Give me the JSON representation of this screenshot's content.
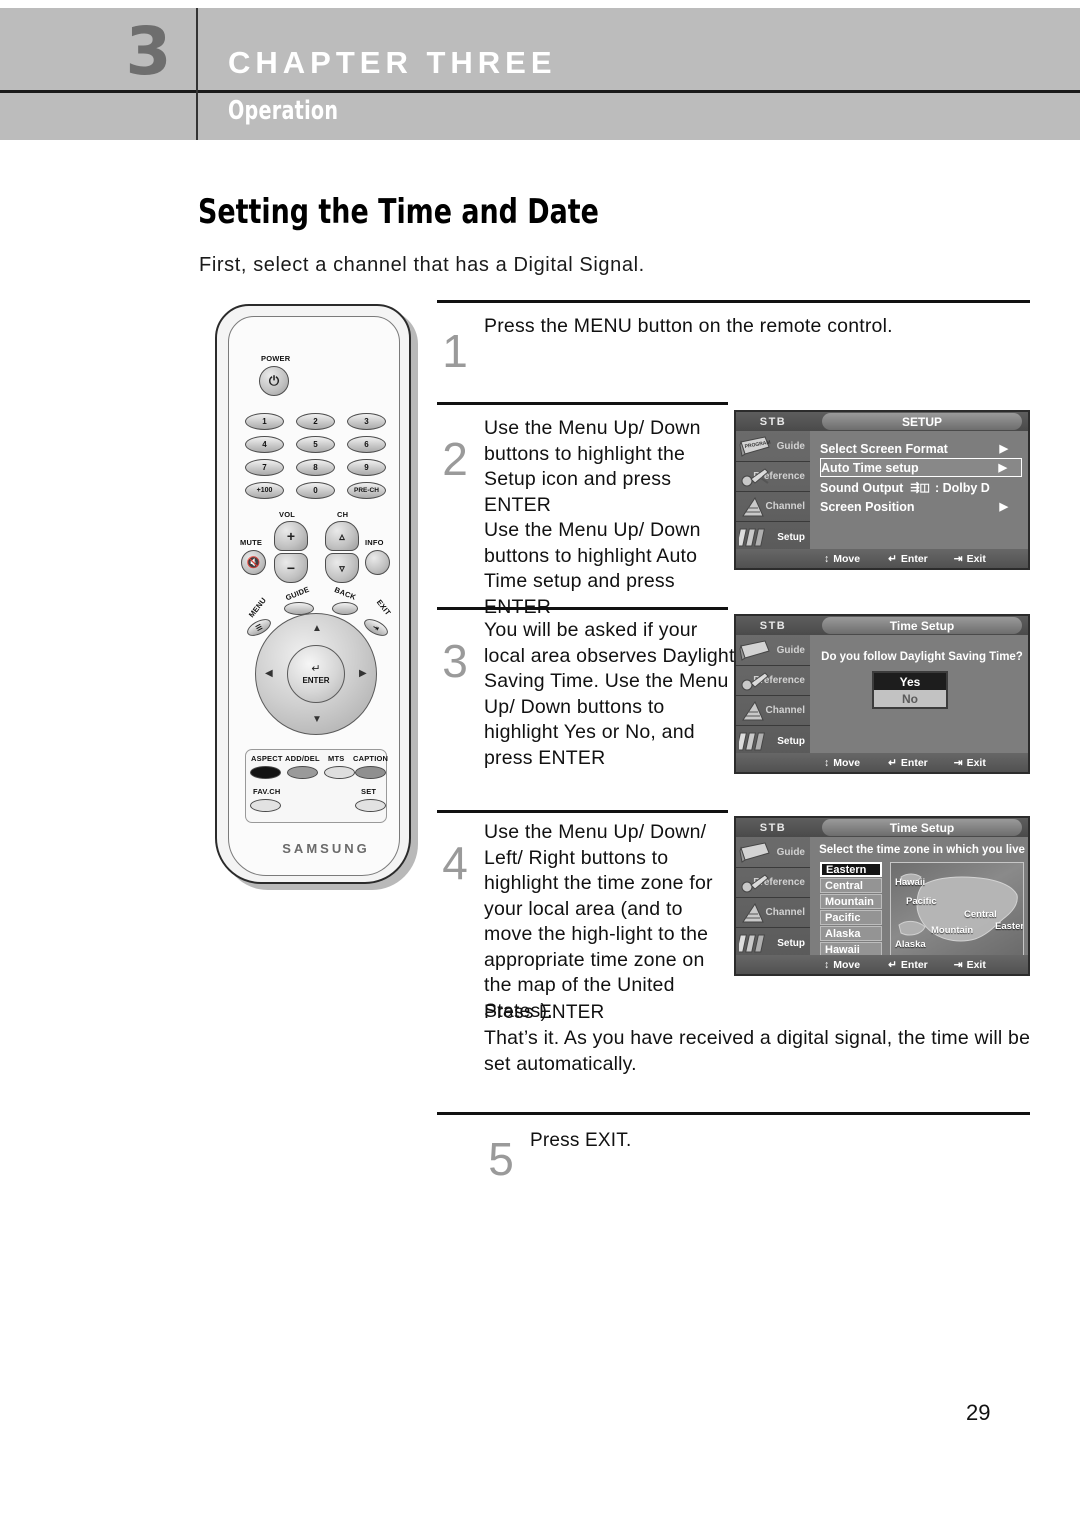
{
  "header": {
    "chapter_number": "3",
    "chapter_title": "CHAPTER THREE",
    "chapter_subtitle": "Operation"
  },
  "page": {
    "title": "Setting the Time and Date",
    "intro": "First, select a channel that has a Digital Signal.",
    "page_number": "29"
  },
  "remote": {
    "brand": "SAMSUNG",
    "power_label": "POWER",
    "keypad": [
      "1",
      "2",
      "3",
      "4",
      "5",
      "6",
      "7",
      "8",
      "9",
      "+100",
      "0",
      "PRE-CH"
    ],
    "vol_label": "VOL",
    "ch_label": "CH",
    "mute_label": "MUTE",
    "info_label": "INFO",
    "menu_label": "MENU",
    "guide_label": "GUIDE",
    "back_label": "BACK",
    "exit_label": "EXIT",
    "enter_label": "ENTER",
    "function_buttons": [
      "ASPECT",
      "ADD/DEL",
      "MTS",
      "CAPTION",
      "FAV.CH",
      "SET"
    ]
  },
  "steps": [
    {
      "number": "1",
      "text": "Press the MENU button on the remote control."
    },
    {
      "number": "2",
      "text": "Use the Menu Up/ Down buttons to highlight the Setup icon and press ENTER\nUse the Menu Up/ Down buttons to highlight Auto Time setup and press ENTER"
    },
    {
      "number": "3",
      "text": "You will be asked if your local area observes Daylight Saving Time. Use the Menu Up/ Down buttons to highlight Yes or No, and press ENTER"
    },
    {
      "number": "4",
      "text": "Use the Menu Up/ Down/ Left/ Right buttons to highlight the time zone for your local area (and to move the high-light to the appropriate time zone on the map of the United States).",
      "extra1": "Press ENTER",
      "extra2": "That’s it. As you have received a digital signal, the time will be set automatically."
    },
    {
      "number": "5",
      "text": "Press EXIT."
    }
  ],
  "osd_common": {
    "stb_label": "STB",
    "sidebar": [
      {
        "label": "Guide",
        "icon": "program-guide-icon",
        "active": false
      },
      {
        "label": "Preference",
        "icon": "wrench-icon",
        "active": false
      },
      {
        "label": "Channel",
        "icon": "antenna-icon",
        "active": false
      },
      {
        "label": "Setup",
        "icon": "sliders-icon",
        "active": true
      }
    ],
    "footer": [
      {
        "label": "Move",
        "icon": "up-down-arrow-icon"
      },
      {
        "label": "Enter",
        "icon": "enter-key-icon"
      },
      {
        "label": "Exit",
        "icon": "exit-key-icon"
      }
    ]
  },
  "osd_setup": {
    "title": "SETUP",
    "rows": [
      {
        "label": "Select Screen Format",
        "caret": "▶",
        "selected": false
      },
      {
        "label": "Auto Time setup",
        "caret": "▶",
        "selected": true
      },
      {
        "label": "Sound Output",
        "value": ": Dolby D",
        "caret": "",
        "selected": false
      },
      {
        "label": "Screen Position",
        "caret": "▶",
        "selected": false
      }
    ]
  },
  "osd_dst": {
    "title": "Time Setup",
    "question": "Do you follow Daylight Saving Time?",
    "options": [
      {
        "label": "Yes",
        "selected": true
      },
      {
        "label": "No",
        "selected": false
      }
    ]
  },
  "osd_timezone": {
    "title": "Time Setup",
    "prompt": "Select the time zone in which you live",
    "zones": [
      {
        "label": "Eastern",
        "selected": true
      },
      {
        "label": "Central",
        "selected": false
      },
      {
        "label": "Mountain",
        "selected": false
      },
      {
        "label": "Pacific",
        "selected": false
      },
      {
        "label": "Alaska",
        "selected": false
      },
      {
        "label": "Hawaii",
        "selected": false
      }
    ],
    "map_labels": [
      "Hawaii",
      "Pacific",
      "Central",
      "Eastern",
      "Mountain",
      "Alaska"
    ]
  },
  "colors": {
    "header_band": "#bcbcbc",
    "chapter_number": "#6e6e6e",
    "step_number": "#9a9a9a",
    "osd_background": "#7d7d7d",
    "osd_highlight": "#151515"
  }
}
